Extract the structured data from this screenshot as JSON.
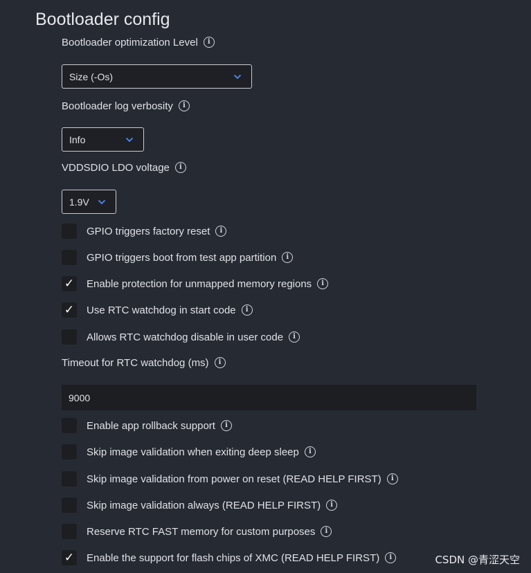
{
  "section": {
    "title": "Bootloader config"
  },
  "fields": {
    "optimization": {
      "label": "Bootloader optimization Level",
      "value": "Size (-Os)"
    },
    "log_verbosity": {
      "label": "Bootloader log verbosity",
      "value": "Info"
    },
    "vddsdio": {
      "label": "VDDSDIO LDO voltage",
      "value": "1.9V"
    },
    "rtc_timeout": {
      "label": "Timeout for RTC watchdog (ms)",
      "value": "9000"
    }
  },
  "checkboxes_group1": [
    {
      "label": "GPIO triggers factory reset",
      "checked": false
    },
    {
      "label": "GPIO triggers boot from test app partition",
      "checked": false
    },
    {
      "label": "Enable protection for unmapped memory regions",
      "checked": true
    },
    {
      "label": "Use RTC watchdog in start code",
      "checked": true
    },
    {
      "label": "Allows RTC watchdog disable in user code",
      "checked": false
    }
  ],
  "checkboxes_group2": [
    {
      "label": "Enable app rollback support",
      "checked": false
    },
    {
      "label": "Skip image validation when exiting deep sleep",
      "checked": false
    },
    {
      "label": "Skip image validation from power on reset (READ HELP FIRST)",
      "checked": false
    },
    {
      "label": "Skip image validation always (READ HELP FIRST)",
      "checked": false
    },
    {
      "label": "Reserve RTC FAST memory for custom purposes",
      "checked": false
    },
    {
      "label": "Enable the support for flash chips of XMC (READ HELP FIRST)",
      "checked": true
    }
  ],
  "icons": {
    "info": "info-icon",
    "chevron": "chevron-down-icon",
    "check": "checkmark-icon"
  },
  "check_glyph": "✓",
  "info_glyph": "i",
  "colors": {
    "background": "#262a33",
    "chevron": "#4a7fe0",
    "text": "#dfe2e6",
    "checkbox_bg": "#1c1e22"
  },
  "watermark": "CSDN @青涩天空"
}
